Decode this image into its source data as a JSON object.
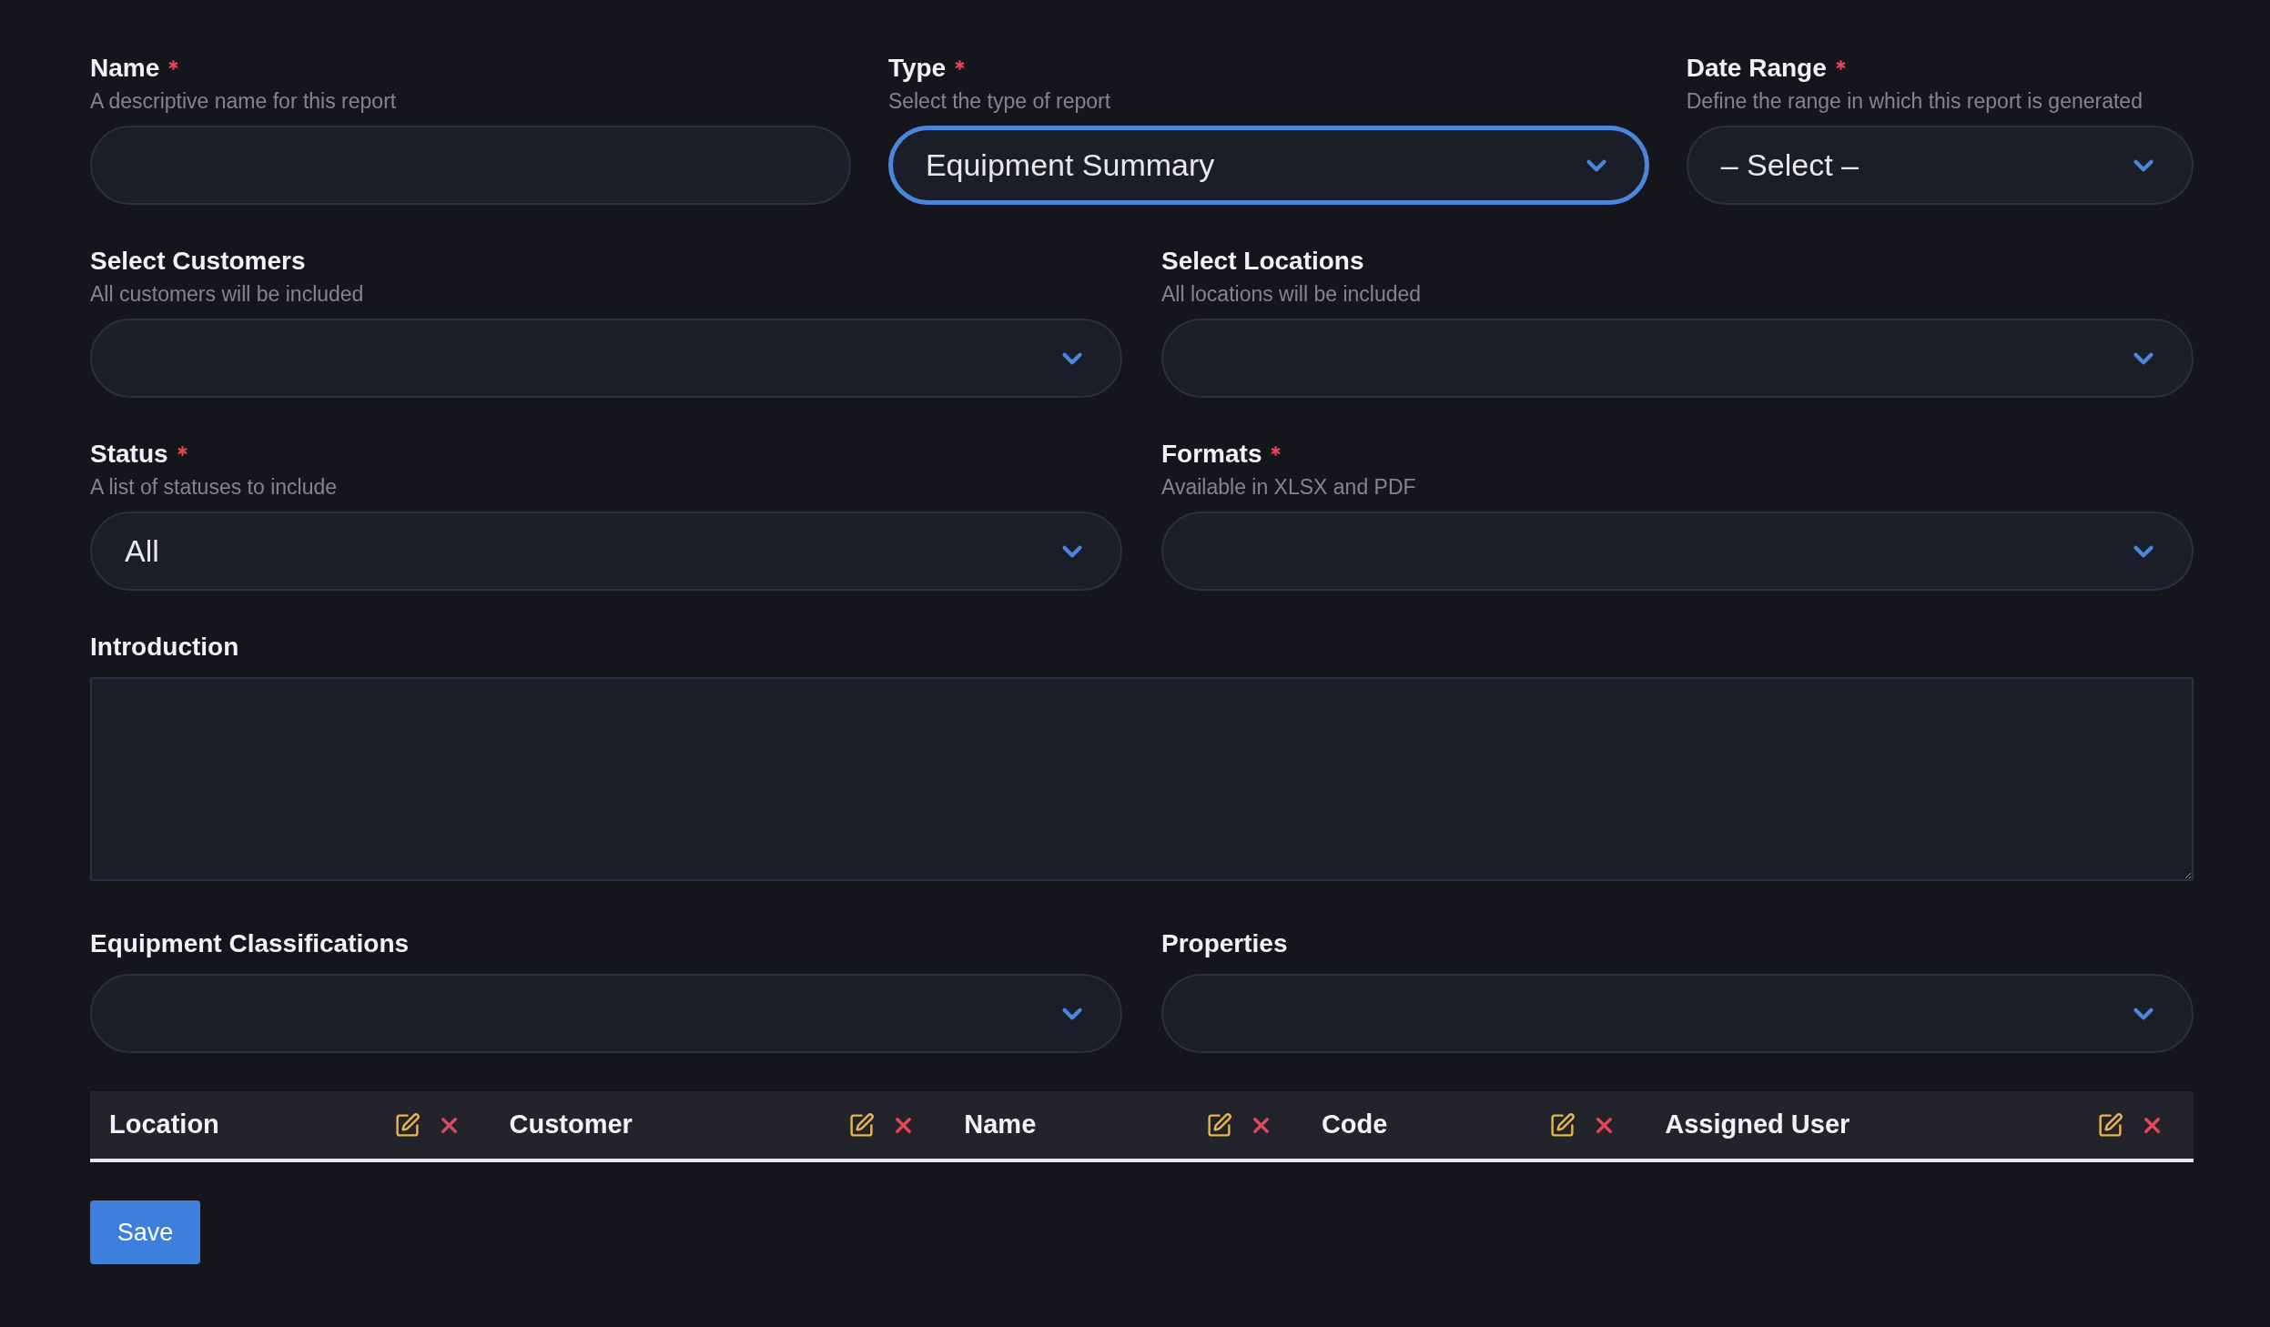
{
  "form_rows": [
    {
      "fields": [
        {
          "kind": "text",
          "label": "Name",
          "required": true,
          "hint": "A descriptive name for this report",
          "focused": false
        },
        {
          "kind": "select",
          "label": "Type",
          "required": true,
          "hint": "Select the type of report",
          "value": "Equipment Summary",
          "focused": true
        },
        {
          "kind": "select",
          "label": "Date Range",
          "required": true,
          "hint": "Define the range in which this report is generated",
          "value": "– Select –",
          "focused": false
        }
      ]
    },
    {
      "fields": [
        {
          "kind": "select",
          "label": "Select Customers",
          "required": false,
          "hint": "All customers will be included",
          "focused": false
        },
        {
          "kind": "select",
          "label": "Select Locations",
          "required": false,
          "hint": "All locations will be included",
          "focused": false
        }
      ]
    },
    {
      "fields": [
        {
          "kind": "select",
          "label": "Status",
          "required": true,
          "hint": "A list of statuses to include",
          "value": "All",
          "focused": false
        },
        {
          "kind": "select",
          "label": "Formats",
          "required": true,
          "hint": "Available in XLSX and PDF",
          "focused": false
        }
      ]
    },
    {
      "fields": [
        {
          "kind": "textarea",
          "label": "Introduction",
          "required": false,
          "focused": false
        }
      ]
    },
    {
      "fields": [
        {
          "kind": "select",
          "label": "Equipment Classifications",
          "required": false,
          "focused": false
        },
        {
          "kind": "select",
          "label": "Properties",
          "required": false,
          "focused": false
        }
      ]
    }
  ],
  "table": {
    "columns": [
      {
        "label": "Location"
      },
      {
        "label": "Customer"
      },
      {
        "label": "Name"
      },
      {
        "label": "Code"
      },
      {
        "label": "Assigned User"
      }
    ]
  },
  "save_button": "Save"
}
